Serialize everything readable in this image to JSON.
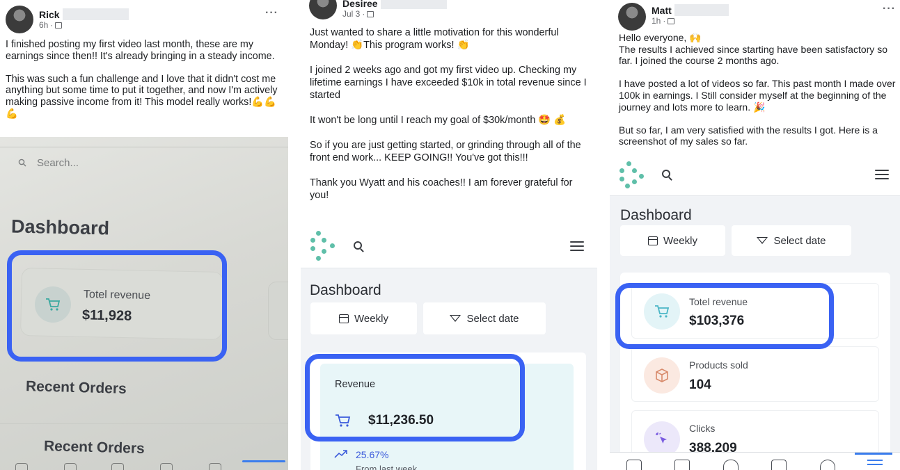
{
  "panels": [
    {
      "author": "Rick",
      "time": "6h",
      "more": "···",
      "text": "I finished posting my first video last month, these are my earnings since then!! It's already bringing in a steady income.\n\nThis was such a fun challenge and I love that it didn't cost me anything but some time to put it together, and now I'm actively making passive income from it! This model really works!💪💪💪",
      "app": {
        "search_placeholder": "Search...",
        "dashboard_title": "Dashboard",
        "card_label": "Totel revenue",
        "card_value": "$11,928",
        "recent_orders_1": "Recent Orders",
        "recent_orders_2": "Recent Orders"
      }
    },
    {
      "author": "Desiree",
      "time": "Jul 3",
      "text": "Just wanted to share a little motivation for this wonderful Monday! 👏This program works! 👏\n\nI joined 2 weeks ago and got my first video up. Checking my lifetime earnings I have exceeded $10k in total revenue since I started\n\nIt won't be long until I reach my goal of $30k/month 🤩 💰\n\nSo if you are just getting started, or grinding through all of the front end work... KEEP GOING!! You've got this!!!\n\nThank you Wyatt and his coaches!! I am forever grateful for you!",
      "app": {
        "dashboard_title": "Dashboard",
        "weekly_label": "Weekly",
        "select_date_label": "Select date",
        "card_label": "Revenue",
        "card_value": "$11,236.50",
        "change_value": "25.67%",
        "change_caption": "From last week"
      }
    },
    {
      "author": "Matt",
      "time": "1h",
      "more": "···",
      "text": "Hello everyone, 🙌\nThe results I achieved since starting have been satisfactory so far. I joined the course 2 months ago.\n\nI have posted a lot of videos so far. This past month I made over 100k in earnings. I Still consider myself at the beginning of the journey and lots more to learn. 🎉\n\nBut so far, I am very satisfied with the results I got. Here is a screenshot of my sales so far.",
      "app": {
        "dashboard_title": "Dashboard",
        "weekly_label": "Weekly",
        "select_date_label": "Select date",
        "cards": [
          {
            "label": "Totel revenue",
            "value": "$103,376",
            "icon": "cart-icon",
            "color": "#e3f4f7"
          },
          {
            "label": "Products sold",
            "value": "104",
            "icon": "box-icon",
            "color": "#fbe9e1"
          },
          {
            "label": "Clicks",
            "value": "388,209",
            "icon": "click-icon",
            "color": "#ece8fa"
          }
        ]
      }
    }
  ],
  "colors": {
    "highlight": "#3a62f3",
    "accent": "#5fbfa9",
    "nav_active": "#3b7ded"
  }
}
